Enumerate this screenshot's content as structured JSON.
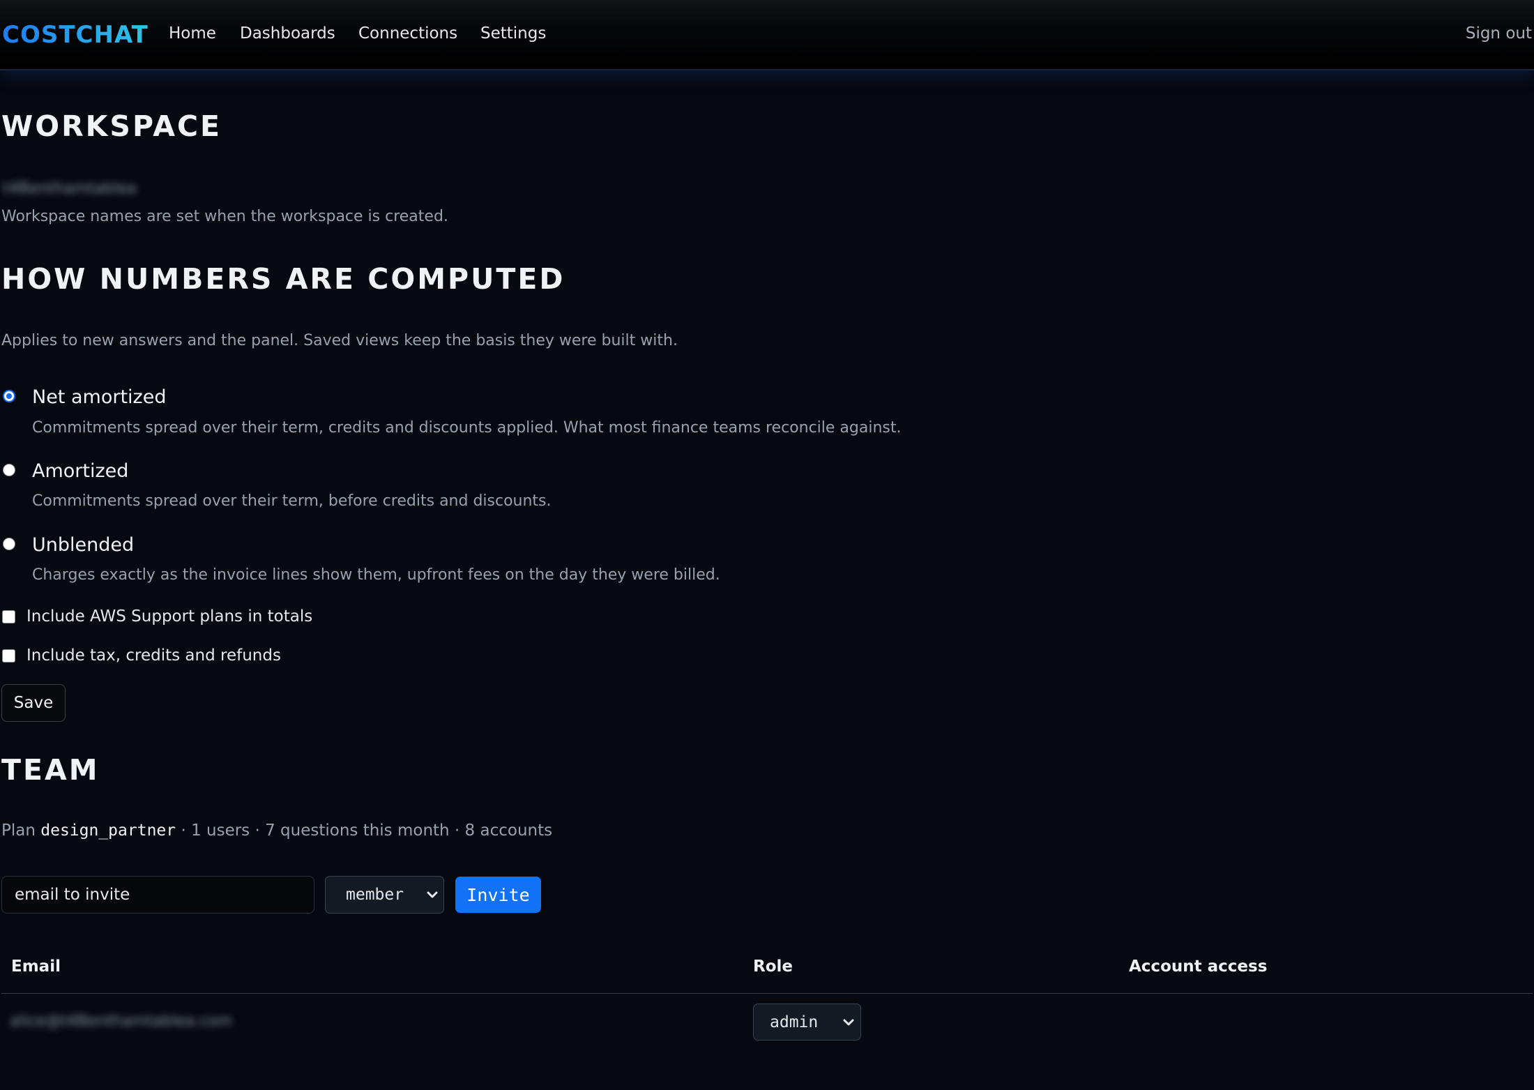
{
  "header": {
    "brand": "COSTCHAT",
    "nav": [
      "Home",
      "Dashboards",
      "Connections",
      "Settings"
    ],
    "sign_out": "Sign out"
  },
  "workspace": {
    "title": "WORKSPACE",
    "name_blurred": "t4Benthamtablea",
    "note": "Workspace names are set when the workspace is created."
  },
  "computation": {
    "title": "HOW NUMBERS ARE COMPUTED",
    "subtitle": "Applies to new answers and the panel. Saved views keep the basis they were built with.",
    "options": [
      {
        "label": "Net amortized",
        "description": "Commitments spread over their term, credits and discounts applied. What most finance teams reconcile against.",
        "selected": true
      },
      {
        "label": "Amortized",
        "description": "Commitments spread over their term, before credits and discounts.",
        "selected": false
      },
      {
        "label": "Unblended",
        "description": "Charges exactly as the invoice lines show them, upfront fees on the day they were billed.",
        "selected": false
      }
    ],
    "checkboxes": [
      {
        "label": "Include AWS Support plans in totals",
        "checked": false
      },
      {
        "label": "Include tax, credits and refunds",
        "checked": false
      }
    ],
    "save_label": "Save"
  },
  "team": {
    "title": "TEAM",
    "plan_prefix": "Plan",
    "plan_name": "design_partner",
    "plan_stats": "· 1 users · 7 questions this month · 8 accounts",
    "invite_placeholder": "email to invite",
    "role_select_value": "member",
    "invite_label": "Invite",
    "table": {
      "headers": [
        "Email",
        "Role",
        "Account access"
      ],
      "rows": [
        {
          "email_blurred": "alice@t4Benthamtablea.com",
          "role": "admin",
          "account_access": ""
        }
      ]
    }
  },
  "colors": {
    "accent": "#1272f5",
    "brand_gradient_start": "#1d7cf2",
    "brand_gradient_end": "#2fc4e6",
    "background": "#060910"
  }
}
